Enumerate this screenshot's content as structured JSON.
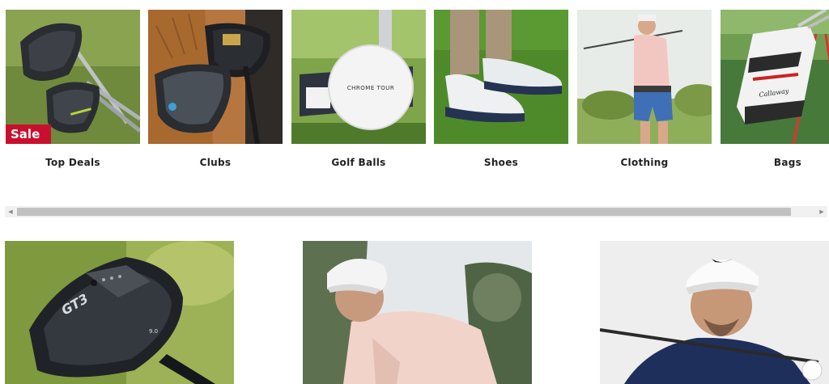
{
  "categories": [
    {
      "label": "Top Deals",
      "badge": "Sale",
      "icon": "golf-drivers-photo"
    },
    {
      "label": "Clubs",
      "icon": "golf-clubs-bag-photo"
    },
    {
      "label": "Golf Balls",
      "ball_text": "CHROME TOUR",
      "icon": "golf-ball-photo"
    },
    {
      "label": "Shoes",
      "icon": "golf-shoes-photo"
    },
    {
      "label": "Clothing",
      "icon": "golfer-swing-photo"
    },
    {
      "label": "Bags",
      "bag_text": "Callaway",
      "icon": "golf-bag-photo"
    }
  ],
  "scrollbar": {
    "left_arrow": "◀",
    "right_arrow": "▶"
  },
  "promos": [
    {
      "club_text": "GT3",
      "loft_text": "9.0",
      "icon": "driver-closeup-photo"
    },
    {
      "icon": "golfer-white-cap-photo"
    },
    {
      "icon": "golfer-nike-cap-photo"
    }
  ]
}
